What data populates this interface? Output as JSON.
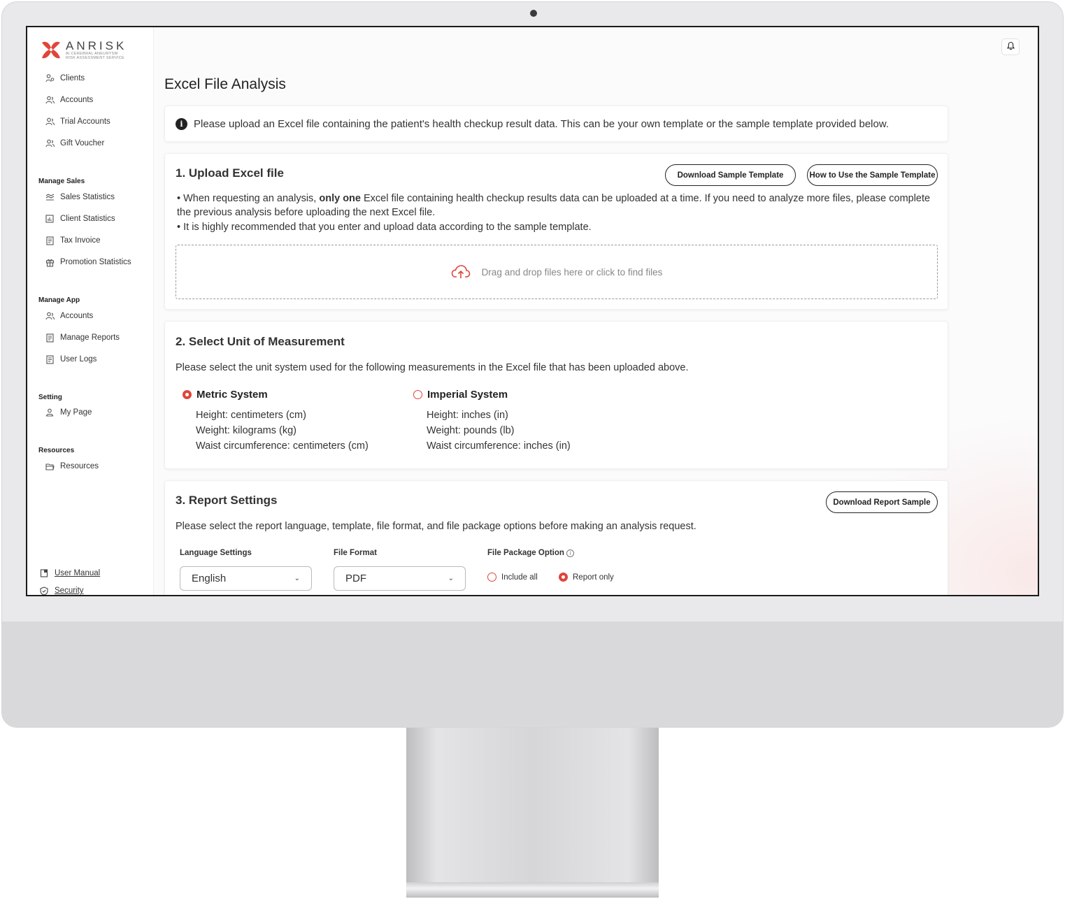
{
  "brand": {
    "name": "ANRISK",
    "tagline_1": "AI CEREBRAL ANEURYSM",
    "tagline_2": "RISK ASSESSMENT SERVICE",
    "accent": "#e0453a"
  },
  "sidebar": {
    "top_items": [
      {
        "label": "Clients",
        "icon": "users-icon"
      },
      {
        "label": "Accounts",
        "icon": "accounts-icon"
      },
      {
        "label": "Trial Accounts",
        "icon": "accounts-icon"
      },
      {
        "label": "Gift Voucher",
        "icon": "accounts-icon"
      }
    ],
    "manage_sales": {
      "heading": "Manage Sales",
      "items": [
        {
          "label": "Sales Statistics",
          "icon": "chart-icon"
        },
        {
          "label": "Client Statistics",
          "icon": "bar-chart-icon"
        },
        {
          "label": "Tax Invoice",
          "icon": "document-icon"
        },
        {
          "label": "Promotion Statistics",
          "icon": "gift-icon"
        }
      ]
    },
    "manage_app": {
      "heading": "Manage App",
      "items": [
        {
          "label": "Accounts",
          "icon": "accounts-icon"
        },
        {
          "label": "Manage Reports",
          "icon": "document-icon"
        },
        {
          "label": "User Logs",
          "icon": "document-icon"
        }
      ]
    },
    "setting": {
      "heading": "Setting",
      "items": [
        {
          "label": "My Page",
          "icon": "user-icon"
        }
      ]
    },
    "resources": {
      "heading": "Resources",
      "items": [
        {
          "label": "Resources",
          "icon": "folder-icon"
        }
      ]
    },
    "footer_links": [
      {
        "label": "User Manual",
        "icon": "book-icon"
      },
      {
        "label": "Security",
        "icon": "shield-icon"
      }
    ]
  },
  "main": {
    "title": "Excel File Analysis",
    "notice": "Please upload an Excel file containing the patient's health checkup result data. This can be your own template or the sample template provided below.",
    "upload": {
      "title": "1. Upload Excel file",
      "download_template": "Download Sample Template",
      "how_to_use": "How to Use the Sample Template",
      "line1_pre": "• When requesting an analysis, ",
      "line1_bold": "only one",
      "line1_post": " Excel file containing health checkup results data can be uploaded at a time. If you need to analyze more files, please complete",
      "line2": "the previous analysis before uploading the next Excel file.",
      "line3": "• It is highly recommended that you enter and upload data according to the sample template.",
      "dropzone": "Drag and drop files here or click to find files"
    },
    "units": {
      "title": "2. Select Unit of Measurement",
      "desc": "Please select the unit system used for the following measurements in the Excel file that has been uploaded above.",
      "metric": {
        "label": "Metric System",
        "selected": true,
        "lines": [
          "Height: centimeters (cm)",
          "Weight: kilograms (kg)",
          "Waist circumference: centimeters (cm)"
        ]
      },
      "imperial": {
        "label": "Imperial System",
        "selected": false,
        "lines": [
          "Height: inches (in)",
          "Weight: pounds (lb)",
          "Waist circumference: inches (in)"
        ]
      }
    },
    "report": {
      "title": "3. Report Settings",
      "download_sample": "Download Report Sample",
      "desc": "Please select the report language, template, file format, and file package options before making an analysis request.",
      "language_label": "Language Settings",
      "language_value": "English",
      "format_label": "File Format",
      "format_value": "PDF",
      "package_label": "File Package Option",
      "package_options": [
        {
          "label": "Include all",
          "selected": false
        },
        {
          "label": "Report only",
          "selected": true
        }
      ]
    }
  }
}
